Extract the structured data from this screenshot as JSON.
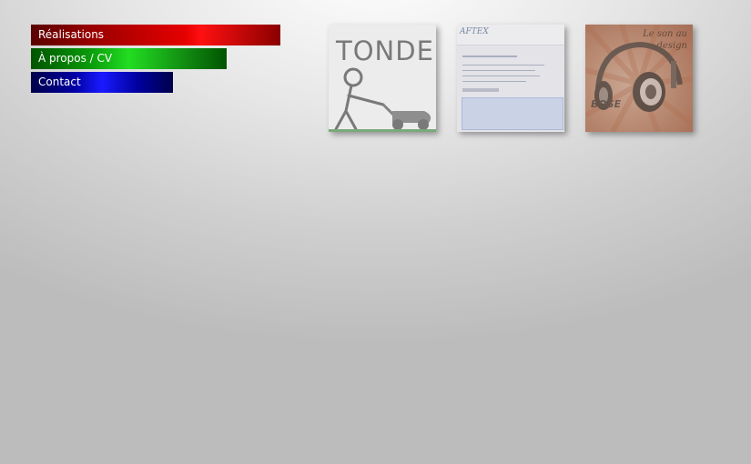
{
  "nav": {
    "items": [
      {
        "label": "Réalisations",
        "color": "#e60000"
      },
      {
        "label": "À propos / CV",
        "color": "#22dd22"
      },
      {
        "label": "Contact",
        "color": "#1a1aff"
      }
    ]
  },
  "thumbnails": [
    {
      "text": "TONDE",
      "icon": "lawnmower-stick-figure"
    },
    {
      "text": "AFTEX",
      "icon": "website-screenshot"
    },
    {
      "text_line1": "Le son au",
      "text_line2": "design",
      "brand": "BOSE",
      "icon": "headphones"
    }
  ],
  "colors": {
    "accent_red": "#e60000",
    "accent_green": "#22dd22",
    "accent_blue": "#1a1aff"
  }
}
